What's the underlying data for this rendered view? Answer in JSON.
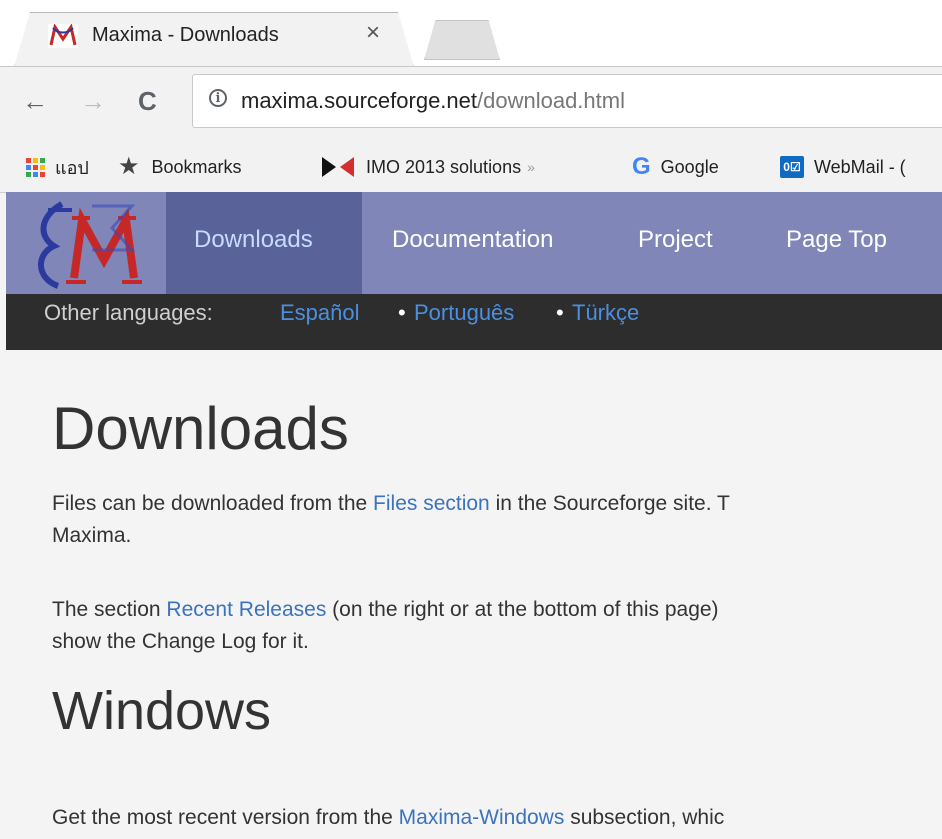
{
  "browser": {
    "tab_title": "Maxima - Downloads",
    "tab_close": "×",
    "url_host": "maxima.sourceforge.net",
    "url_path": "/download.html",
    "nav": {
      "back": "←",
      "forward": "→",
      "reload": "C"
    },
    "info_glyph": "i",
    "bookmarks": [
      {
        "label": "แอป",
        "icon": "apps-grid-icon"
      },
      {
        "label": "Bookmarks",
        "icon": "star-icon"
      },
      {
        "label": "IMO 2013 solutions",
        "icon": "imo-logo-icon"
      },
      {
        "label": "Google",
        "icon": "google-g-icon"
      },
      {
        "label": "WebMail - (",
        "icon": "outlook-icon"
      }
    ],
    "overflow_glyph": "»",
    "google_glyph": "G",
    "outlook_glyph": "0☑"
  },
  "site": {
    "nav": [
      "Downloads",
      "Documentation",
      "Project",
      "Page Top"
    ],
    "other_languages_label": "Other languages:",
    "languages": [
      "Español",
      "Português",
      "Türkçe"
    ],
    "separator": "•"
  },
  "content": {
    "heading": "Downloads",
    "p1": {
      "before": "Files can be downloaded from the ",
      "link": "Files section",
      "after": " in the Sourceforge site. T",
      "line2": "Maxima."
    },
    "p2": {
      "before": "The section ",
      "link": "Recent Releases",
      "after": " (on the right or at the bottom of this page)",
      "line2": "show the Change Log for it."
    },
    "heading2": "Windows",
    "p3": {
      "before": "Get the most recent version from the ",
      "link": "Maxima-Windows",
      "after": " subsection, whic"
    }
  },
  "colors": {
    "nav_bg": "#8087b8",
    "nav_active_bg": "#5a629a",
    "nav_active_text": "#c5dcff",
    "lang_bar_bg": "#2d2d2d",
    "link": "#3b73bd"
  }
}
